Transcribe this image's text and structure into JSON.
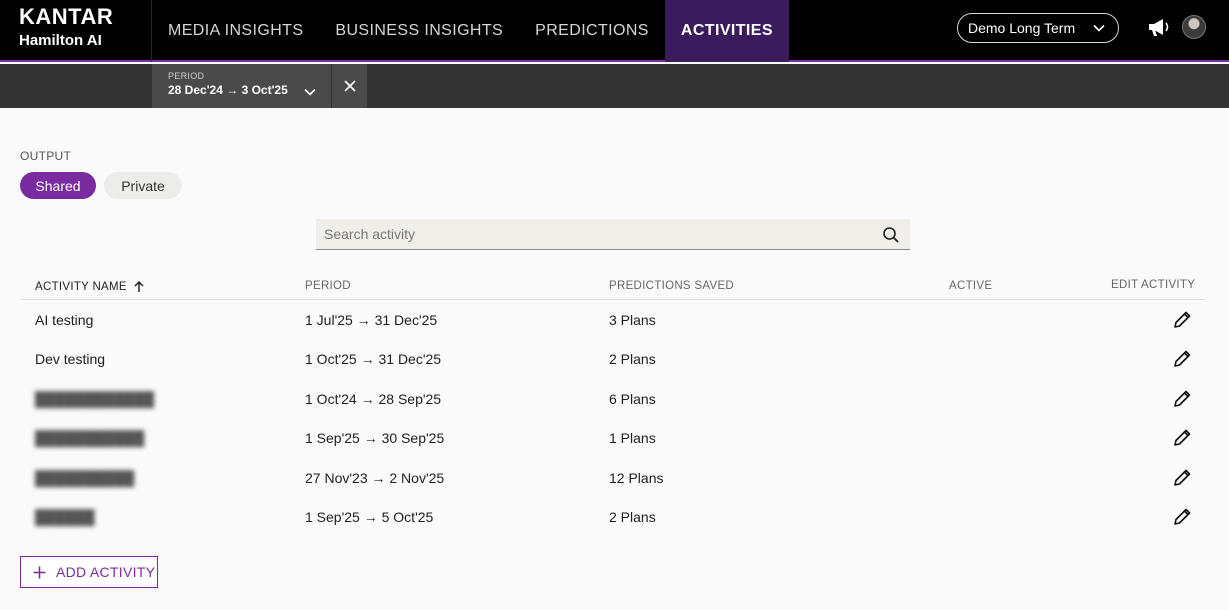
{
  "brand": {
    "line1": "KANTAR",
    "line2": "Hamilton AI"
  },
  "nav": {
    "items": [
      {
        "label": "MEDIA INSIGHTS",
        "active": false
      },
      {
        "label": "BUSINESS INSIGHTS",
        "active": false
      },
      {
        "label": "PREDICTIONS",
        "active": false
      },
      {
        "label": "ACTIVITIES",
        "active": true
      }
    ]
  },
  "account": {
    "label": "Demo Long Term"
  },
  "filter": {
    "period_label": "PERIOD",
    "period_value": "28 Dec'24 → 3 Oct'25"
  },
  "output": {
    "label": "OUTPUT",
    "shared": "Shared",
    "private": "Private",
    "selected": "Shared"
  },
  "search": {
    "placeholder": "Search activity",
    "value": ""
  },
  "table": {
    "columns": {
      "name": "ACTIVITY NAME",
      "period": "PERIOD",
      "predictions": "PREDICTIONS SAVED",
      "active": "ACTIVE",
      "edit": "EDIT ACTIVITY"
    },
    "rows": [
      {
        "name": "AI testing",
        "period": "1 Jul'25 → 31 Dec'25",
        "predictions": "3 Plans"
      },
      {
        "name": "Dev testing",
        "period": "1 Oct'25 → 31 Dec'25",
        "predictions": "2 Plans"
      },
      {
        "name": "",
        "period": "1 Oct'24 → 28 Sep'25",
        "predictions": "6 Plans"
      },
      {
        "name": "",
        "period": "1 Sep'25 → 30 Sep'25",
        "predictions": "1 Plans"
      },
      {
        "name": "",
        "period": "27 Nov'23 → 2 Nov'25",
        "predictions": "12 Plans"
      },
      {
        "name": "",
        "period": "1 Sep'25 → 5 Oct'25",
        "predictions": "2 Plans"
      }
    ]
  },
  "add_button": {
    "label": "ADD ACTIVITY"
  },
  "colors": {
    "accent": "#7a2ba0",
    "nav_active": "#3a1c5c",
    "topbar": "#000000"
  }
}
